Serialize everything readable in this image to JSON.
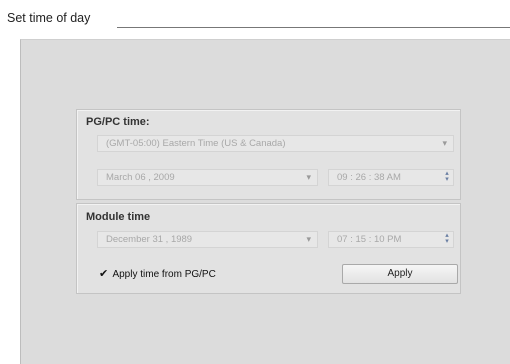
{
  "dialog": {
    "title": "Set time of day"
  },
  "pgpc": {
    "title": "PG/PC time:",
    "timezone": "(GMT-05:00) Eastern Time (US & Canada)",
    "date": "March  06 ,  2009",
    "time": "09 : 26 : 38  AM"
  },
  "module": {
    "title": "Module time",
    "date": "December  31 ,  1989",
    "time": "07 : 15 : 10  PM",
    "apply_from_pgpc_label": "Apply time from PG/PC",
    "apply_from_pgpc_checked": true,
    "apply_button": "Apply"
  },
  "icons": {
    "dropdown": "chevron-down-icon",
    "spinner": "spin-up-down-icon",
    "check": "checkmark-icon"
  },
  "glyphs": {
    "down": "▾",
    "up": "▴",
    "check": "✔"
  }
}
